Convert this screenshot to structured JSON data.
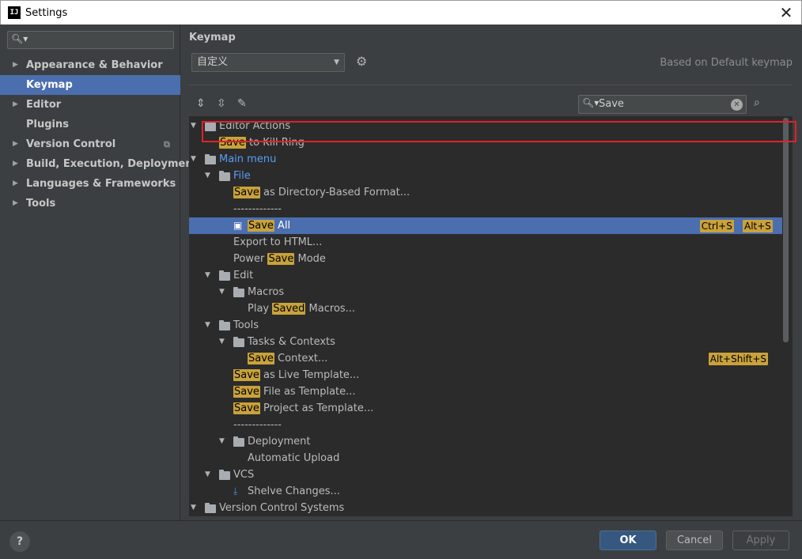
{
  "window": {
    "title": "Settings",
    "app_icon": "IJ"
  },
  "sidebar": {
    "items": [
      {
        "label": "Appearance & Behavior",
        "expandable": true,
        "selected": false
      },
      {
        "label": "Keymap",
        "expandable": false,
        "selected": true
      },
      {
        "label": "Editor",
        "expandable": true,
        "selected": false
      },
      {
        "label": "Plugins",
        "expandable": false,
        "selected": false
      },
      {
        "label": "Version Control",
        "expandable": true,
        "selected": false
      },
      {
        "label": "Build, Execution, Deployment",
        "expandable": true,
        "selected": false
      },
      {
        "label": "Languages & Frameworks",
        "expandable": true,
        "selected": false
      },
      {
        "label": "Tools",
        "expandable": true,
        "selected": false
      }
    ]
  },
  "keymap": {
    "title": "Keymap",
    "selected_keymap": "自定义",
    "based_on": "Based on Default keymap",
    "search_value": "Save",
    "tree": [
      {
        "depth": 0,
        "expanded": true,
        "icon": "editor-actions",
        "pre": "Editor Actions",
        "hl": "",
        "post": "",
        "blue": false
      },
      {
        "depth": 1,
        "icon": "none",
        "pre": "",
        "hl": "Save",
        "post": " to Kill Ring"
      },
      {
        "depth": 0,
        "expanded": true,
        "icon": "menu",
        "pre": "Main menu",
        "hl": "",
        "post": "",
        "blue": true
      },
      {
        "depth": 1,
        "expanded": true,
        "icon": "folder",
        "pre": "File",
        "hl": "",
        "post": "",
        "blue": true
      },
      {
        "depth": 2,
        "icon": "none",
        "pre": "",
        "hl": "Save",
        "post": " as Directory-Based Format..."
      },
      {
        "depth": 2,
        "icon": "none",
        "pre": "-------------",
        "hl": "",
        "post": ""
      },
      {
        "depth": 2,
        "icon": "save",
        "pre": "",
        "hl": "Save",
        "post": " All",
        "selected": true,
        "shortcuts": [
          "Ctrl+S",
          "Alt+S"
        ]
      },
      {
        "depth": 2,
        "icon": "none",
        "pre": "Export to HTML...",
        "hl": "",
        "post": ""
      },
      {
        "depth": 2,
        "icon": "none",
        "pre": "Power ",
        "hl": "Save",
        "post": " Mode"
      },
      {
        "depth": 1,
        "expanded": true,
        "icon": "folder",
        "pre": "Edit",
        "hl": "",
        "post": ""
      },
      {
        "depth": 2,
        "expanded": true,
        "icon": "folder",
        "pre": "Macros",
        "hl": "",
        "post": ""
      },
      {
        "depth": 3,
        "icon": "none",
        "pre": "Play ",
        "hl": "Saved",
        "post": " Macros..."
      },
      {
        "depth": 1,
        "expanded": true,
        "icon": "folder",
        "pre": "Tools",
        "hl": "",
        "post": ""
      },
      {
        "depth": 2,
        "expanded": true,
        "icon": "folder",
        "pre": "Tasks & Contexts",
        "hl": "",
        "post": ""
      },
      {
        "depth": 3,
        "icon": "none",
        "pre": "",
        "hl": "Save",
        "post": " Context...",
        "shortcuts": [
          "Alt+Shift+S"
        ]
      },
      {
        "depth": 2,
        "icon": "none",
        "pre": "",
        "hl": "Save",
        "post": " as Live Template..."
      },
      {
        "depth": 2,
        "icon": "none",
        "pre": "",
        "hl": "Save",
        "post": " File as Template..."
      },
      {
        "depth": 2,
        "icon": "none",
        "pre": "",
        "hl": "Save",
        "post": " Project as Template..."
      },
      {
        "depth": 2,
        "icon": "none",
        "pre": "-------------",
        "hl": "",
        "post": ""
      },
      {
        "depth": 2,
        "expanded": true,
        "icon": "folder",
        "pre": "Deployment",
        "hl": "",
        "post": ""
      },
      {
        "depth": 3,
        "icon": "none",
        "pre": "Automatic Upload",
        "hl": "",
        "post": ""
      },
      {
        "depth": 1,
        "expanded": true,
        "icon": "folder",
        "pre": "VCS",
        "hl": "",
        "post": ""
      },
      {
        "depth": 2,
        "icon": "shelve",
        "pre": "Shelve Changes...",
        "hl": "",
        "post": ""
      },
      {
        "depth": 0,
        "expanded": true,
        "icon": "menu",
        "pre": "Version Control Systems",
        "hl": "",
        "post": ""
      }
    ]
  },
  "footer": {
    "help": "?",
    "ok": "OK",
    "cancel": "Cancel",
    "apply": "Apply"
  },
  "colors": {
    "accent": "#4b6eaf",
    "highlight": "#c9a23b",
    "outline": "#e0212b"
  }
}
